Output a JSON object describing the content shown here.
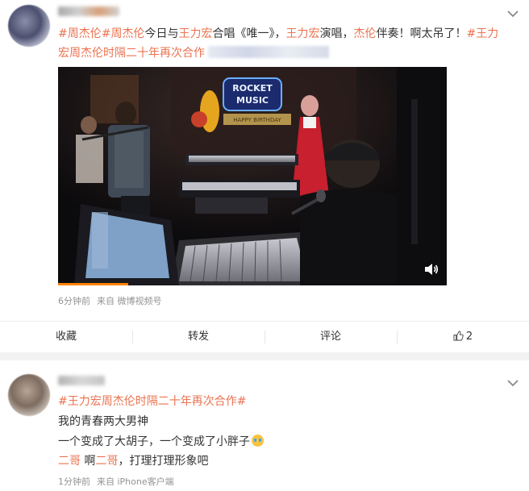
{
  "post": {
    "text_parts": [
      {
        "text": "#周杰伦",
        "tag": true
      },
      {
        "text": "#周杰伦",
        "tag": true
      },
      {
        "text": "今日与",
        "tag": false
      },
      {
        "text": "王力宏",
        "tag": true
      },
      {
        "text": "合唱《唯一》，",
        "tag": false
      },
      {
        "text": "王力宏",
        "tag": true
      },
      {
        "text": "演唱，",
        "tag": false
      },
      {
        "text": "杰伦",
        "tag": true
      },
      {
        "text": "伴奏！啊太吊了！",
        "tag": false
      },
      {
        "text": "#王力宏周杰伦时隔二十年再次合作",
        "tag": true
      }
    ],
    "video": {
      "sign_text_1": "ROCKET",
      "sign_text_2": "MUSIC",
      "banner_text": "HAPPY BIRTHDAY",
      "progress": 0.18
    },
    "meta": {
      "time": "6分钟前",
      "source": "来自 微博视频号"
    },
    "actions": {
      "favorite": "收藏",
      "repost": "转发",
      "comment": "评论",
      "like_count": "2"
    }
  },
  "reply": {
    "tag": "#王力宏周杰伦时隔二十年再次合作#",
    "line1": "我的青春两大男神",
    "line2": "一个变成了大胡子，一个变成了小胖子",
    "line3_parts": [
      {
        "text": "二哥",
        "tag": true
      },
      {
        "text": " 啊",
        "tag": false
      },
      {
        "text": "二哥",
        "tag": true
      },
      {
        "text": "，打理打理形象吧",
        "tag": false
      }
    ],
    "meta": {
      "time": "1分钟前",
      "source": "来自 iPhone客户端"
    }
  },
  "colors": {
    "accent": "#eb7350",
    "progress": "#ff8200"
  },
  "icons": [
    "chevron-down-icon",
    "volume-icon",
    "like-icon"
  ]
}
